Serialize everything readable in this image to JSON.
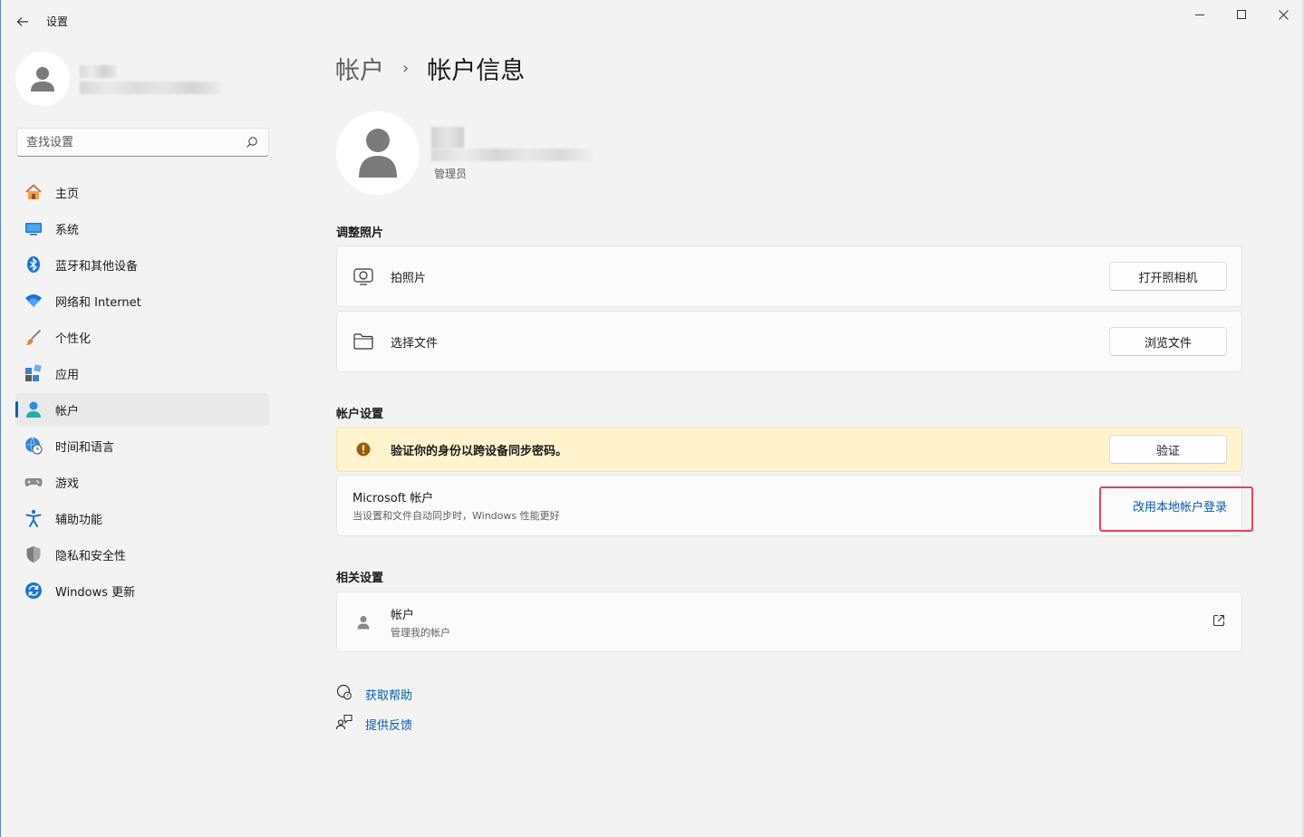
{
  "window": {
    "title": "设置",
    "controls": {
      "minimize": "minimize",
      "maximize": "maximize",
      "close": "close"
    }
  },
  "sidebar": {
    "search": {
      "placeholder": "查找设置"
    },
    "items": [
      {
        "label": "主页",
        "icon": "home-icon"
      },
      {
        "label": "系统",
        "icon": "system-icon"
      },
      {
        "label": "蓝牙和其他设备",
        "icon": "bluetooth-icon"
      },
      {
        "label": "网络和 Internet",
        "icon": "wifi-icon"
      },
      {
        "label": "个性化",
        "icon": "brush-icon"
      },
      {
        "label": "应用",
        "icon": "apps-icon"
      },
      {
        "label": "帐户",
        "icon": "account-icon",
        "active": true
      },
      {
        "label": "时间和语言",
        "icon": "globe-clock-icon"
      },
      {
        "label": "游戏",
        "icon": "gamepad-icon"
      },
      {
        "label": "辅助功能",
        "icon": "accessibility-icon"
      },
      {
        "label": "隐私和安全性",
        "icon": "shield-icon"
      },
      {
        "label": "Windows 更新",
        "icon": "update-icon"
      }
    ]
  },
  "main": {
    "breadcrumb": {
      "parent": "帐户",
      "separator": "›",
      "current": "帐户信息"
    },
    "profile": {
      "role": "管理员"
    },
    "adjust_photo": {
      "title": "调整照片",
      "rows": [
        {
          "label": "拍照片",
          "icon": "camera-icon",
          "button": "打开照相机"
        },
        {
          "label": "选择文件",
          "icon": "folder-icon",
          "button": "浏览文件"
        }
      ]
    },
    "account_settings": {
      "title": "帐户设置",
      "warning": {
        "text": "验证你的身份以跨设备同步密码。",
        "button": "验证",
        "icon": "warning-icon"
      },
      "microsoft": {
        "title": "Microsoft 帐户",
        "subtitle": "当设置和文件自动同步时，Windows 性能更好",
        "link": "改用本地帐户登录"
      }
    },
    "related": {
      "title": "相关设置",
      "item": {
        "title": "帐户",
        "subtitle": "管理我的帐户",
        "icon": "person-icon"
      }
    },
    "help": {
      "get_help": "获取帮助",
      "feedback": "提供反馈"
    }
  },
  "colors": {
    "accent": "#005fb8",
    "highlight": "#e8425a",
    "warning_bg": "#fff4ce"
  }
}
